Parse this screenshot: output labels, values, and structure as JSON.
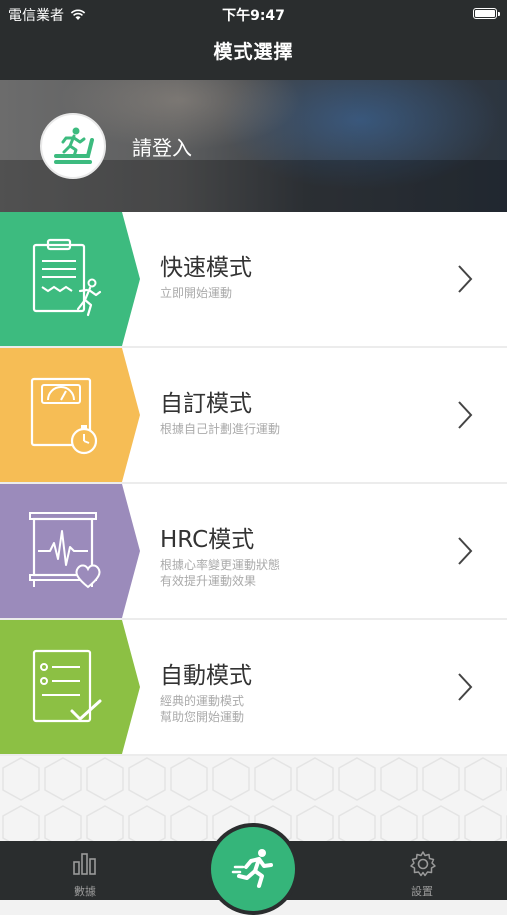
{
  "status": {
    "carrier": "電信業者",
    "time": "下午9:47"
  },
  "nav": {
    "title": "模式選擇"
  },
  "profile": {
    "login_label": "請登入"
  },
  "modes": [
    {
      "title": "快速模式",
      "sub1": "立即開始運動",
      "sub2": "",
      "color": "#3dbb7f",
      "icon": "clipboard-runner-icon"
    },
    {
      "title": "自訂模式",
      "sub1": "根據自己計劃進行運動",
      "sub2": "",
      "color": "#f6bd55",
      "icon": "scale-stopwatch-icon"
    },
    {
      "title": "HRC模式",
      "sub1": "根據心率變更運動狀態",
      "sub2": "有效提升運動效果",
      "color": "#9b8bbb",
      "icon": "heart-monitor-icon"
    },
    {
      "title": "自動模式",
      "sub1": "經典的運動模式",
      "sub2": "幫助您開始運動",
      "color": "#8cc044",
      "icon": "checklist-icon"
    }
  ],
  "tabbar": {
    "data_label": "數據",
    "settings_label": "設置"
  },
  "colors": {
    "dark": "#2a2d2e",
    "accent": "#35b57a"
  }
}
